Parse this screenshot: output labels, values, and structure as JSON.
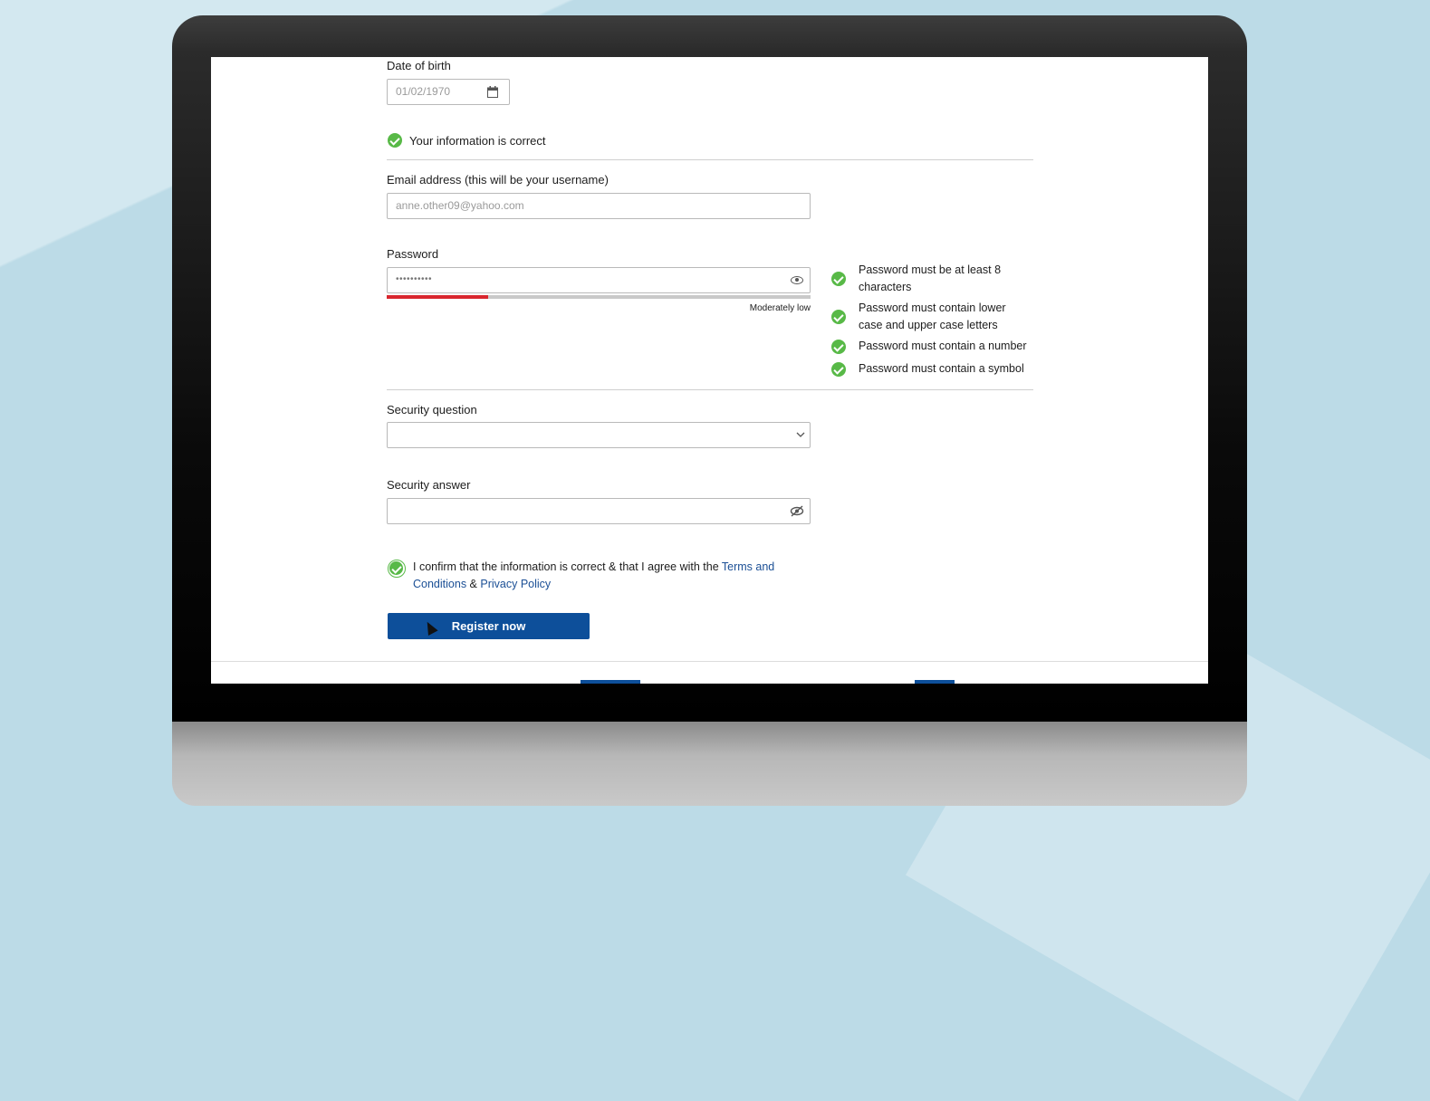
{
  "form": {
    "dob": {
      "label": "Date of birth",
      "value": "01/02/1970"
    },
    "info_status": "Your information is correct",
    "email": {
      "label": "Email address (this will be your username)",
      "value": "anne.other09@yahoo.com"
    },
    "password": {
      "label": "Password",
      "masked_value": "••••••••••",
      "strength_label": "Moderately low",
      "strength_fraction": 0.24,
      "strength_color": "#d9262e"
    },
    "password_rules": [
      {
        "text": "Password must be at least 8 characters"
      },
      {
        "text": "Password must  contain lower case and upper case letters"
      },
      {
        "text": "Password must  contain a number"
      },
      {
        "text": "Password must  contain a symbol"
      }
    ],
    "security_question": {
      "label": "Security question",
      "value": ""
    },
    "security_answer": {
      "label": "Security answer",
      "value": ""
    },
    "consent": {
      "text_before": "I confirm that the information is correct & that I agree with the ",
      "terms_link": "Terms and Conditions",
      "ampersand": " & ",
      "privacy_link": "Privacy Policy"
    },
    "register_button": "Register now"
  },
  "icons": {
    "calendar": "calendar-icon",
    "check": "check-circle-icon",
    "show_password": "eye-icon",
    "hide_answer": "eye-slash-icon",
    "dropdown": "chevron-down-icon"
  },
  "colors": {
    "accent": "#0d4f9a",
    "success": "#58b947",
    "link": "#1b4f95"
  }
}
